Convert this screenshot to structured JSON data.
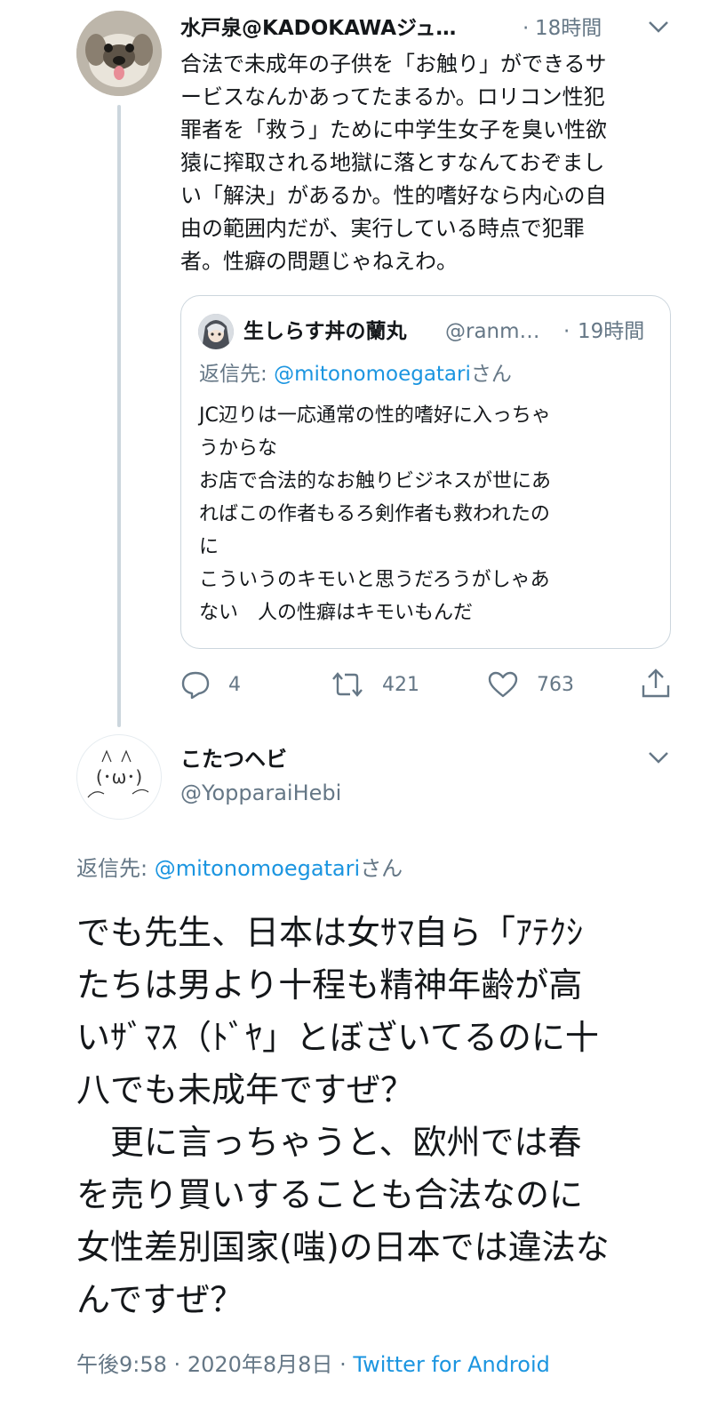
{
  "tweet1": {
    "author_name": "水戸泉@KADOKAWAジュ…",
    "separator": "·",
    "time": "18時間",
    "avatar_icon": "dog-avatar-icon",
    "text": "合法で未成年の子供を「お触り」ができるサ\nービスなんかあってたまるか。ロリコン性犯\n罪者を「救う」ために中学生女子を臭い性欲\n猿に搾取される地獄に落とすなんておぞまし\nい「解決」があるか。性的嗜好なら内心の自\n由の範囲内だが、実行している時点で犯罪\n者。性癖の問題じゃねえわ。",
    "quote": {
      "author_name": "生しらす丼の蘭丸",
      "handle": "@ranm…",
      "separator": "·",
      "time": "19時間",
      "reply_prefix": "返信先: ",
      "reply_handle": "@mitonomoegatari",
      "reply_suffix": "さん",
      "text": "JC辺りは一応通常の性的嗜好に入っちゃ\nうからな\nお店で合法的なお触りビジネスが世にあ\nればこの作者もるろ剣作者も救われたの\nに\nこういうのキモいと思うだろうがしゃあ\nない　人の性癖はキモいもんだ"
    },
    "actions": {
      "reply_count": "4",
      "retweet_count": "421",
      "like_count": "763"
    }
  },
  "tweet2": {
    "author_name": "こたつヘビ",
    "handle": "@YopparaiHebi",
    "avatar_art": "(･ω･)",
    "reply_prefix": "返信先: ",
    "reply_handle": "@mitonomoegatari",
    "reply_suffix": "さん",
    "text": "でも先生、日本は女ｻﾏ自ら「ｱﾃｸｼ\nたちは男より十程も精神年齢が高\nいｻﾞﾏｽ（ﾄﾞﾔ」とぼざいてるのに十\n八でも未成年ですぜ？\n　更に言っちゃうと、欧州では春\nを売り買いすることも合法なのに\n女性差別国家(嗤)の日本では違法な\nんですぜ？",
    "footer_time": "午後9:58",
    "footer_sep1": "·",
    "footer_date": "2020年8月8日",
    "footer_sep2": "·",
    "footer_source": "Twitter for Android"
  },
  "colors": {
    "text": "#14171a",
    "muted": "#657786",
    "link": "#1b95e0",
    "border": "#ccd6dd"
  }
}
